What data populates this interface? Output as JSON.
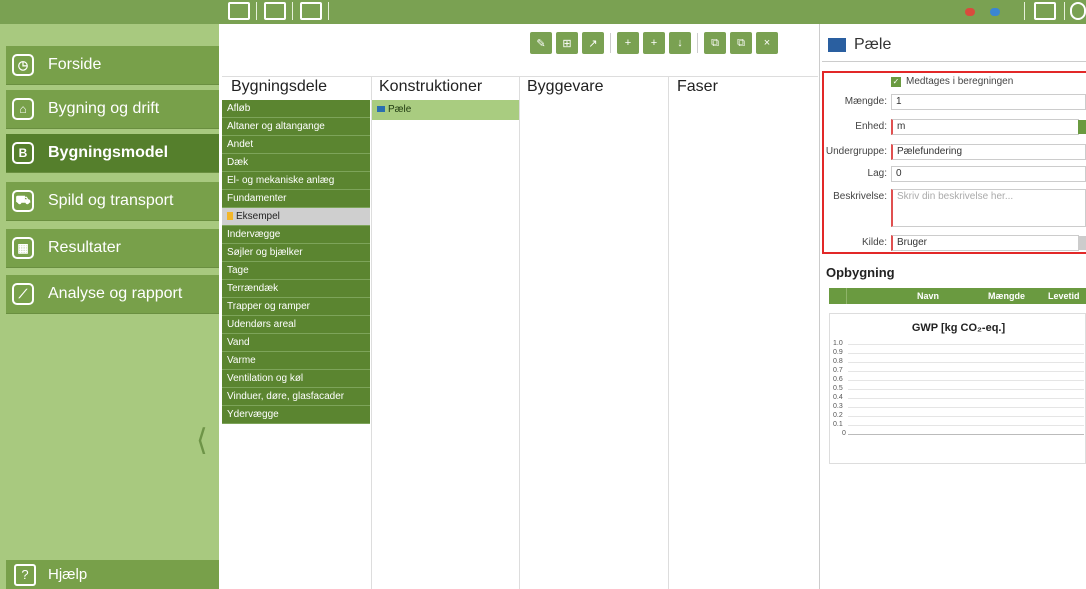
{
  "sidebar": {
    "items": [
      {
        "label": "Forside",
        "icon": "clock-icon"
      },
      {
        "label": "Bygning og drift",
        "icon": "house-icon"
      },
      {
        "label": "Bygningsmodel",
        "icon": "building-model-icon"
      },
      {
        "label": "Spild og transport",
        "icon": "truck-icon"
      },
      {
        "label": "Resultater",
        "icon": "table-icon"
      },
      {
        "label": "Analyse og rapport",
        "icon": "chart-icon"
      }
    ],
    "help_label": "Hjælp"
  },
  "columns": {
    "bygningsdele": "Bygningsdele",
    "konstruktioner": "Konstruktioner",
    "byggevare": "Byggevare",
    "faser": "Faser"
  },
  "bygningsdele_items": [
    "Afløb",
    "Altaner og altangange",
    "Andet",
    "Dæk",
    "El- og mekaniske anlæg",
    "Fundamenter",
    "Eksempel",
    "Indervægge",
    "Søjler og bjælker",
    "Tage",
    "Terrændæk",
    "Trapper og ramper",
    "Udendørs areal",
    "Vand",
    "Varme",
    "Ventilation og køl",
    "Vinduer, døre, glasfacader",
    "Ydervægge"
  ],
  "konstruktioner_items": [
    "Pæle"
  ],
  "panel": {
    "title": "Pæle",
    "checkbox_label": "Medtages i beregningen",
    "maengde_label": "Mængde:",
    "maengde_value": "1",
    "enhed_label": "Enhed:",
    "enhed_value": "m",
    "undergruppe_label": "Undergruppe:",
    "undergruppe_value": "Pælefundering",
    "lag_label": "Lag:",
    "lag_value": "0",
    "beskrivelse_label": "Beskrivelse:",
    "beskrivelse_placeholder": "Skriv din beskrivelse her...",
    "kilde_label": "Kilde:",
    "kilde_value": "Bruger"
  },
  "opbygning": {
    "title": "Opbygning",
    "headers": [
      "Navn",
      "Mængde",
      "Levetid"
    ],
    "chart_title": "GWP [kg CO₂-eq.]",
    "ticks": [
      "1.0",
      "0.9",
      "0.8",
      "0.7",
      "0.6",
      "0.5",
      "0.4",
      "0.3",
      "0.2",
      "0.1",
      "0"
    ]
  }
}
